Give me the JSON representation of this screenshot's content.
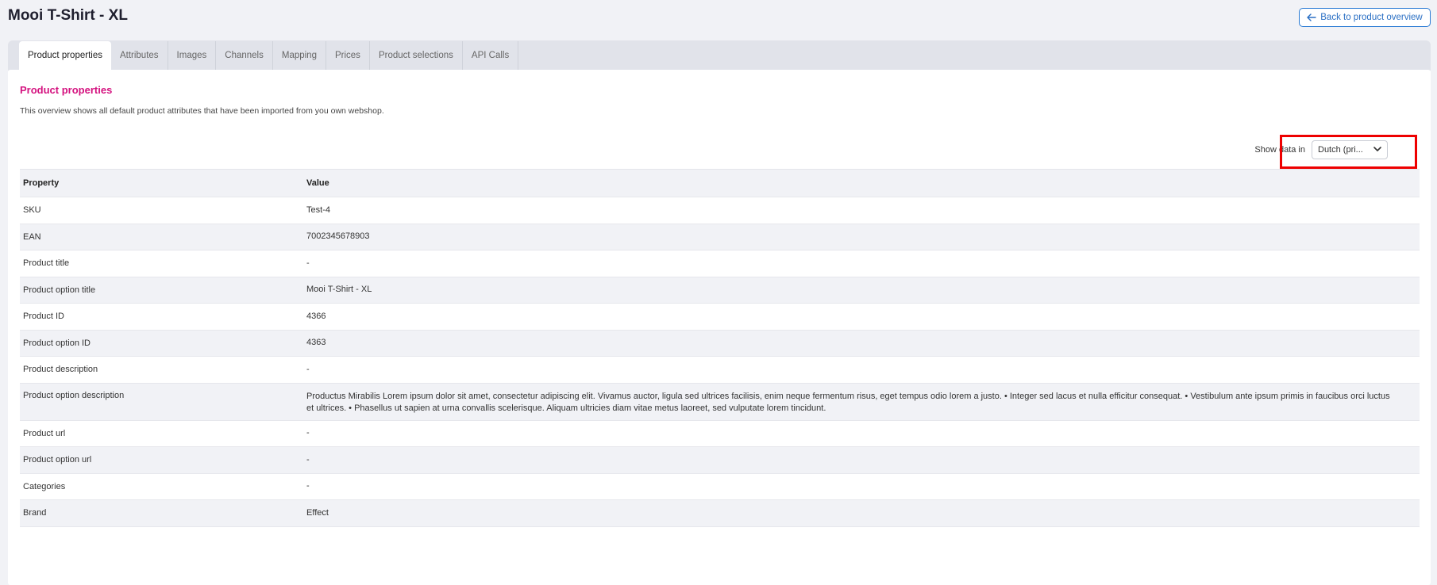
{
  "page": {
    "title": "Mooi T-Shirt - XL",
    "back_button": "Back to product overview"
  },
  "tabs": [
    {
      "label": "Product properties"
    },
    {
      "label": "Attributes"
    },
    {
      "label": "Images"
    },
    {
      "label": "Channels"
    },
    {
      "label": "Mapping"
    },
    {
      "label": "Prices"
    },
    {
      "label": "Product selections"
    },
    {
      "label": "API Calls"
    }
  ],
  "section": {
    "title": "Product properties",
    "description": "This overview shows all default product attributes that have been imported from you own webshop."
  },
  "language": {
    "label": "Show data in",
    "selected": "Dutch (pri..."
  },
  "table": {
    "columns": [
      "Property",
      "Value"
    ],
    "rows": [
      [
        "SKU",
        "Test-4"
      ],
      [
        "EAN",
        "7002345678903"
      ],
      [
        "Product title",
        "-"
      ],
      [
        "Product option title",
        "Mooi T-Shirt - XL"
      ],
      [
        "Product ID",
        "4366"
      ],
      [
        "Product option ID",
        "4363"
      ],
      [
        "Product description",
        "-"
      ],
      [
        "Product option description",
        "Productus Mirabilis Lorem ipsum dolor sit amet, consectetur adipiscing elit. Vivamus auctor, ligula sed ultrices facilisis, enim neque fermentum risus, eget tempus odio lorem a justo. • Integer sed lacus et nulla efficitur consequat. • Vestibulum ante ipsum primis in faucibus orci luctus et ultrices. • Phasellus ut sapien at urna convallis scelerisque. Aliquam ultricies diam vitae metus laoreet, sed vulputate lorem tincidunt."
      ],
      [
        "Product url",
        "-"
      ],
      [
        "Product option url",
        "-"
      ],
      [
        "Categories",
        "-"
      ],
      [
        "Brand",
        "Effect"
      ]
    ]
  },
  "colors": {
    "accent_pink": "#d4127f",
    "button_blue": "#2a6fc4",
    "highlight_red": "#ee0000"
  },
  "icons": {
    "back": "arrow-left-icon",
    "dropdown": "chevron-down-icon"
  }
}
